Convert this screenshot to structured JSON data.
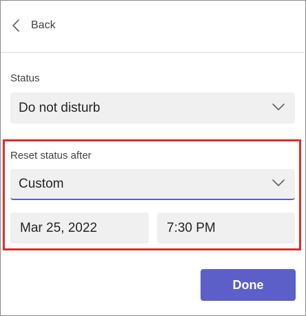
{
  "header": {
    "back_label": "Back",
    "back_icon": "chevron-left-icon"
  },
  "status": {
    "label": "Status",
    "value": "Do not disturb",
    "icon": "chevron-down-icon"
  },
  "reset": {
    "label": "Reset status after",
    "value": "Custom",
    "icon": "chevron-down-icon",
    "date": "Mar 25, 2022",
    "time": "7:30 PM"
  },
  "actions": {
    "done_label": "Done"
  },
  "colors": {
    "accent": "#5b5fc7",
    "highlight_border": "#e02b2b",
    "field_background": "#f0f0f0"
  }
}
